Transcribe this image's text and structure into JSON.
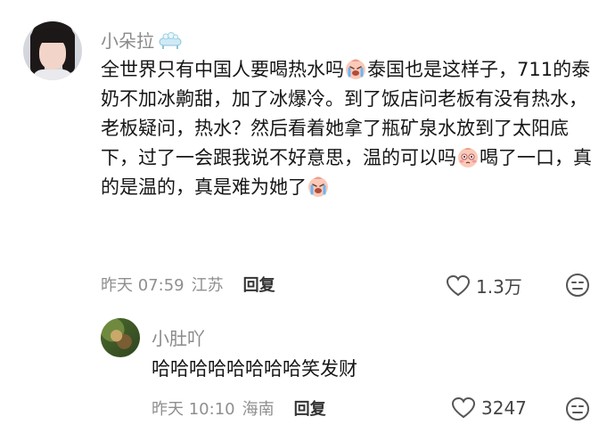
{
  "comment": {
    "username": "小朵拉",
    "badge_icon": "bathtub-icon",
    "text_parts": [
      "全世界只有中国人要喝热水吗",
      "泰国也是这样子，711的泰奶不加冰齁甜，加了冰爆冷。到了饭店问老板有没有热水，老板疑问，热水？然后看着她拿了瓶矿泉水放到了太阳底下，过了一会跟我说不好意思，温的可以吗",
      "喝了一口，真的是温的，真是难为她了"
    ],
    "emojis": [
      "crying-face-icon",
      "flushed-face-icon",
      "crying-face-icon"
    ],
    "time": "昨天 07:59",
    "location": "江苏",
    "reply_label": "回复",
    "likes": "1.3万"
  },
  "reply": {
    "username": "小肚吖",
    "text": "哈哈哈哈哈哈哈哈笑发财",
    "time": "昨天 10:10",
    "location": "海南",
    "reply_label": "回复",
    "likes": "3247"
  }
}
